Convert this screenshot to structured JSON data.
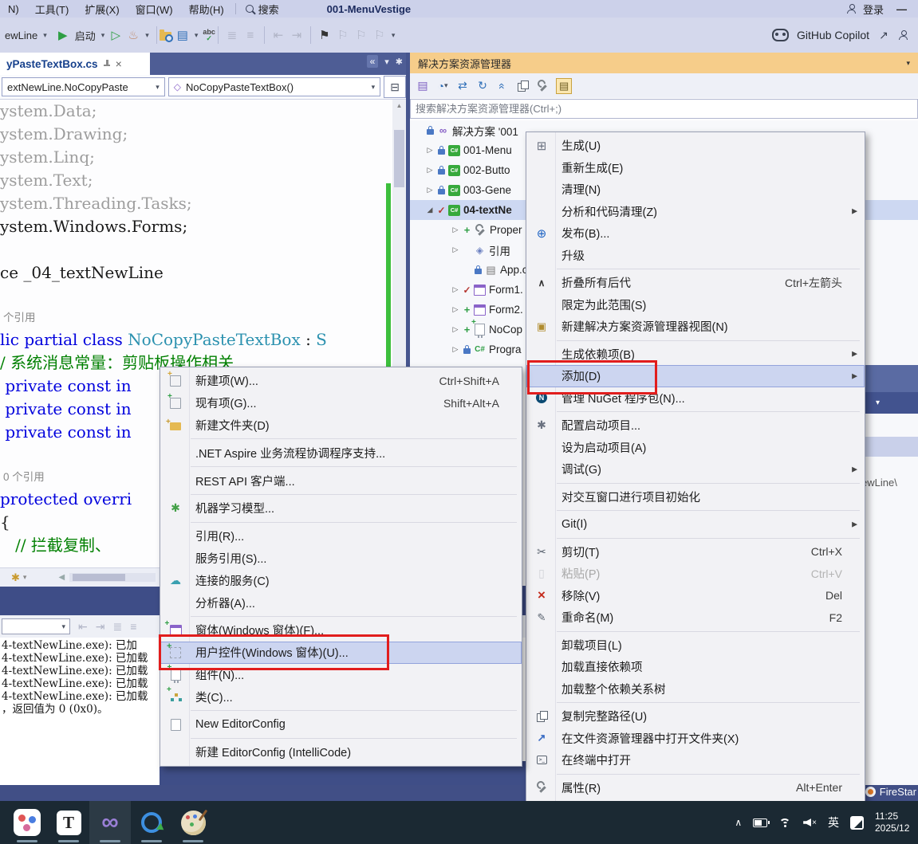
{
  "colors": {
    "annotation_red": "#e11d1d",
    "menu_highlight": "#ccd5f0",
    "se_title_bg": "#f6cd8a",
    "taskbar_bg": "#1b2933",
    "tabbar_bg": "#4e5d95",
    "output_header_bg": "#3e4d87",
    "code_keyword": "#0101dd",
    "code_type": "#2b91af",
    "code_comment": "#008000"
  },
  "icons": {
    "build": "⊞",
    "globe": "⊕",
    "collapse": "∧",
    "newview": "▣",
    "nuget": "N",
    "gear": "✱",
    "scissors": "✂",
    "paste": "▯",
    "removex": "×",
    "rename": "✎",
    "copy": "",
    "openext": "↗",
    "terminal": ">_",
    "wrench": "",
    "newitem": "",
    "existingitem": "",
    "newfolder": "",
    "ml": "✱",
    "cloud": "☁",
    "form": "",
    "usercontrol": "",
    "component": "",
    "classicon": "",
    "document": "",
    "solution": "∞",
    "csproj": "C#",
    "references": "◈",
    "configdoc": "▤",
    "csfile": "C#",
    "playfilled": "▶",
    "playoutline": "▷",
    "flame": "♨",
    "dropdown": "▾",
    "bookmark": "⚑",
    "bookmarkgray": "⚐",
    "chevrons": "«",
    "gearlight": "✱",
    "split": "⊟",
    "cube": "◇",
    "uparrow": "▲",
    "backarrow": "◀",
    "switchviews": "▤",
    "pending": "◔",
    "sync": "⇄",
    "refresh": "↻",
    "collapseall": "«",
    "showall": "▤",
    "expcollapsed": "▷",
    "expexpanded": "◢",
    "check": "✓",
    "plus": "+",
    "graylines": "≣",
    "graylines2": "≡",
    "grayarrow": "⇤",
    "grayarrow2": "⇥",
    "traychevron": "∧",
    "minimize": "—",
    "share": "↗",
    "abc": "abc",
    "healthwand": "✱",
    "submenuarrow": "▶"
  },
  "menubar": {
    "items": [
      "N)",
      "工具(T)",
      "扩展(X)",
      "窗口(W)",
      "帮助(H)"
    ],
    "search_label": "搜索",
    "solution_title": "001-MenuVestige",
    "signin_label": "登录"
  },
  "toolbar": {
    "run_config": "ewLine",
    "start_label": "启动",
    "copilot_label": "GitHub Copilot"
  },
  "editor": {
    "tab_title": "yPasteTextBox.cs",
    "breadcrumb_type": "extNewLine.NoCopyPaste",
    "breadcrumb_member": "NoCopyPasteTextBox()",
    "code_lines": [
      {
        "type": "code",
        "segments": [
          {
            "t": "ystem.Data;",
            "c": "dim"
          }
        ]
      },
      {
        "type": "code",
        "segments": [
          {
            "t": "ystem.Drawing;",
            "c": "dim"
          }
        ]
      },
      {
        "type": "code",
        "segments": [
          {
            "t": "ystem.Linq;",
            "c": "dim"
          }
        ]
      },
      {
        "type": "code",
        "segments": [
          {
            "t": "ystem.Text;",
            "c": "dim"
          }
        ]
      },
      {
        "type": "code",
        "segments": [
          {
            "t": "ystem.Threading.Tasks;",
            "c": "dim"
          }
        ]
      },
      {
        "type": "code",
        "segments": [
          {
            "t": "ystem.Windows.Forms;",
            "c": "plain"
          }
        ]
      },
      {
        "type": "code",
        "segments": []
      },
      {
        "type": "code",
        "segments": [
          {
            "t": "ce _04_textNewLine",
            "c": "plain"
          }
        ]
      },
      {
        "type": "code",
        "segments": []
      },
      {
        "type": "lens",
        "segments": [
          {
            "t": "个引用",
            "c": "lens"
          }
        ]
      },
      {
        "type": "code",
        "segments": [
          {
            "t": "lic partial class ",
            "c": "kw"
          },
          {
            "t": "NoCopyPasteTextBox",
            "c": "type"
          },
          {
            "t": " : ",
            "c": "plain"
          },
          {
            "t": "S",
            "c": "type"
          }
        ]
      },
      {
        "type": "code",
        "segments": [
          {
            "t": "/ 系统消息常量：剪贴板操作相关",
            "c": "comment"
          }
        ]
      },
      {
        "type": "code",
        "segments": [
          {
            "t": " private const in",
            "c": "kw"
          }
        ]
      },
      {
        "type": "code",
        "segments": [
          {
            "t": " private const in",
            "c": "kw"
          }
        ]
      },
      {
        "type": "code",
        "segments": [
          {
            "t": " private const in",
            "c": "kw"
          }
        ]
      },
      {
        "type": "code",
        "segments": []
      },
      {
        "type": "lens",
        "segments": [
          {
            "t": "0 个引用",
            "c": "lens"
          }
        ]
      },
      {
        "type": "code",
        "segments": [
          {
            "t": "protected overri",
            "c": "kw"
          }
        ]
      },
      {
        "type": "code",
        "segments": [
          {
            "t": "{",
            "c": "plain"
          }
        ]
      },
      {
        "type": "code",
        "segments": [
          {
            "t": "   ",
            "c": "plain"
          },
          {
            "t": "// 拦截复制、",
            "c": "comment"
          }
        ]
      }
    ]
  },
  "solution_explorer": {
    "title": "解决方案资源管理器",
    "search_placeholder": "搜索解决方案资源管理器(Ctrl+;)",
    "toolbar_icons": [
      {
        "name": "switch-views",
        "glyph": "switchviews",
        "purple": true
      },
      {
        "name": "pending-changes-filter",
        "glyph": "pending",
        "dropdown": true
      },
      {
        "name": "sync-with-active-document",
        "glyph": "sync"
      },
      {
        "name": "refresh",
        "glyph": "refresh"
      },
      {
        "name": "collapse-all",
        "glyph": "collapseall",
        "rot": true
      },
      {
        "name": "properties",
        "glyph": "copyicon"
      },
      {
        "name": "wrench",
        "glyph": "wrench"
      },
      {
        "name": "show-all-files",
        "glyph": "showall",
        "active": true
      }
    ],
    "tree": [
      {
        "name": "solution",
        "level": 0,
        "expander": null,
        "status": "lock",
        "icon": "solution",
        "label": "解决方案 '001"
      },
      {
        "name": "project-001-menu",
        "level": 1,
        "expander": "collapsed",
        "status": "lock",
        "icon": "csproj",
        "label": "001-Menu"
      },
      {
        "name": "project-002-button",
        "level": 1,
        "expander": "collapsed",
        "status": "lock",
        "icon": "csproj",
        "label": "002-Butto"
      },
      {
        "name": "project-003-general",
        "level": 1,
        "expander": "collapsed",
        "status": "lock",
        "icon": "csproj",
        "label": "003-Gene"
      },
      {
        "name": "project-04-textnewline",
        "level": 1,
        "expander": "expanded",
        "status": "check",
        "icon": "csproj",
        "label": "04-textNe",
        "bold": true,
        "selected": true
      },
      {
        "name": "properties-node",
        "level": 2,
        "expander": "collapsed",
        "status": "plus",
        "icon": "wrench",
        "label": "Proper"
      },
      {
        "name": "references-node",
        "level": 2,
        "expander": "collapsed",
        "status": null,
        "icon": "references",
        "label": "引用"
      },
      {
        "name": "app-config",
        "level": 3,
        "expander": null,
        "status": "lock",
        "icon": "configdoc",
        "label": "App.co"
      },
      {
        "name": "form1",
        "level": 2,
        "expander": "collapsed",
        "status": "check",
        "icon": "form",
        "label": "Form1."
      },
      {
        "name": "form2",
        "level": 2,
        "expander": "collapsed",
        "status": "plus",
        "icon": "form",
        "label": "Form2."
      },
      {
        "name": "nocopypaste-node",
        "level": 2,
        "expander": "collapsed",
        "status": "plus",
        "icon": "component",
        "label": "NoCop"
      },
      {
        "name": "program-cs",
        "level": 2,
        "expander": "collapsed",
        "status": "lock",
        "icon": "csfile",
        "label": "Progra"
      }
    ]
  },
  "context_menu": {
    "items": [
      {
        "name": "build",
        "label": "生成(U)",
        "icon": "build"
      },
      {
        "name": "rebuild",
        "label": "重新生成(E)"
      },
      {
        "name": "clean",
        "label": "清理(N)"
      },
      {
        "name": "analyze-and-code-cleanup",
        "label": "分析和代码清理(Z)",
        "submenu": true
      },
      {
        "name": "publish",
        "label": "发布(B)...",
        "icon": "globe"
      },
      {
        "name": "upgrade",
        "label": "升级"
      },
      {
        "sep": true
      },
      {
        "name": "collapse-all-descendants",
        "label": "折叠所有后代",
        "icon": "collapse",
        "shortcut": "Ctrl+左箭头"
      },
      {
        "name": "scope-to-this",
        "label": "限定为此范围(S)"
      },
      {
        "name": "new-solution-explorer-view",
        "label": "新建解决方案资源管理器视图(N)",
        "icon": "newview"
      },
      {
        "sep": true
      },
      {
        "name": "build-dependencies",
        "label": "生成依赖项(B)",
        "submenu": true
      },
      {
        "name": "add",
        "label": "添加(D)",
        "submenu": true,
        "highlighted": true
      },
      {
        "name": "manage-nuget-packages",
        "label": "管理 NuGet 程序包(N)...",
        "icon": "nuget"
      },
      {
        "sep": true
      },
      {
        "name": "configure-startup-projects",
        "label": "配置启动项目...",
        "icon": "gear"
      },
      {
        "name": "set-as-startup-project",
        "label": "设为启动项目(A)"
      },
      {
        "name": "debug",
        "label": "调试(G)",
        "submenu": true
      },
      {
        "sep": true
      },
      {
        "name": "initialize-project-in-interactive-window",
        "label": "对交互窗口进行项目初始化"
      },
      {
        "sep": true
      },
      {
        "name": "git",
        "label": "Git(I)",
        "submenu": true
      },
      {
        "sep": true
      },
      {
        "name": "cut",
        "label": "剪切(T)",
        "icon": "scissors",
        "shortcut": "Ctrl+X"
      },
      {
        "name": "paste",
        "label": "粘贴(P)",
        "icon": "paste",
        "shortcut": "Ctrl+V",
        "disabled": true
      },
      {
        "name": "remove",
        "label": "移除(V)",
        "icon": "removex",
        "shortcut": "Del"
      },
      {
        "name": "rename",
        "label": "重命名(M)",
        "icon": "rename",
        "shortcut": "F2"
      },
      {
        "sep": true
      },
      {
        "name": "unload-project",
        "label": "卸载项目(L)"
      },
      {
        "name": "load-direct-dependencies",
        "label": "加载直接依赖项"
      },
      {
        "name": "load-entire-dependency-tree",
        "label": "加载整个依赖关系树"
      },
      {
        "sep": true
      },
      {
        "name": "copy-full-path",
        "label": "复制完整路径(U)",
        "icon": "copy"
      },
      {
        "name": "open-folder-in-file-explorer",
        "label": "在文件资源管理器中打开文件夹(X)",
        "icon": "openext"
      },
      {
        "name": "open-in-terminal",
        "label": "在终端中打开",
        "icon": "terminal"
      },
      {
        "sep": true
      },
      {
        "name": "properties",
        "label": "属性(R)",
        "icon": "wrench",
        "shortcut": "Alt+Enter"
      }
    ]
  },
  "add_submenu": {
    "items": [
      {
        "name": "new-item",
        "label": "新建项(W)...",
        "icon": "newitem",
        "shortcut": "Ctrl+Shift+A"
      },
      {
        "name": "existing-item",
        "label": "现有项(G)...",
        "icon": "existingitem",
        "shortcut": "Shift+Alt+A"
      },
      {
        "name": "new-folder",
        "label": "新建文件夹(D)",
        "icon": "newfolder"
      },
      {
        "sep": true
      },
      {
        "name": "aspire-orchestrator-support",
        "label": ".NET Aspire 业务流程协调程序支持..."
      },
      {
        "sep": true
      },
      {
        "name": "rest-api-client",
        "label": "REST API 客户端..."
      },
      {
        "sep": true
      },
      {
        "name": "machine-learning-model",
        "label": "机器学习模型...",
        "icon": "ml"
      },
      {
        "sep": true
      },
      {
        "name": "reference",
        "label": "引用(R)..."
      },
      {
        "name": "service-reference",
        "label": "服务引用(S)..."
      },
      {
        "name": "connected-service",
        "label": "连接的服务(C)",
        "icon": "cloud"
      },
      {
        "name": "analyzer",
        "label": "分析器(A)..."
      },
      {
        "sep": true
      },
      {
        "name": "windows-form",
        "label": "窗体(Windows 窗体)(F)...",
        "icon": "form"
      },
      {
        "name": "user-control-windows-forms",
        "label": "用户控件(Windows 窗体)(U)...",
        "icon": "usercontrol",
        "highlighted": true
      },
      {
        "name": "component",
        "label": "组件(N)...",
        "icon": "component"
      },
      {
        "name": "class",
        "label": "类(C)...",
        "icon": "classicon"
      },
      {
        "sep": true
      },
      {
        "name": "new-editorconfig",
        "label": "New EditorConfig",
        "icon": "document"
      },
      {
        "sep": true
      },
      {
        "name": "new-editorconfig-intellicode",
        "label": "新建 EditorConfig (IntelliCode)"
      }
    ]
  },
  "output_panel": {
    "lines": [
      "4-textNewLine.exe): 已加",
      "4-textNewLine.exe): 已加载",
      "4-textNewLine.exe): 已加载",
      "4-textNewLine.exe): 已加载",
      "4-textNewLine.exe): 已加载",
      "，返回值为 0 (0x0)。"
    ]
  },
  "background": {
    "path_fragment": "ewLine\\",
    "firestar_label": "FireStar"
  },
  "taskbar": {
    "apps": [
      {
        "name": "colorful-app",
        "kind": "colorful"
      },
      {
        "name": "typora",
        "kind": "letter",
        "letter": "T"
      },
      {
        "name": "visual-studio",
        "kind": "vs",
        "active": true
      },
      {
        "name": "chat-app",
        "kind": "ring"
      },
      {
        "name": "paint-app",
        "kind": "palette"
      }
    ],
    "ime_label": "英",
    "time": "11:25",
    "date": "2025/12"
  }
}
